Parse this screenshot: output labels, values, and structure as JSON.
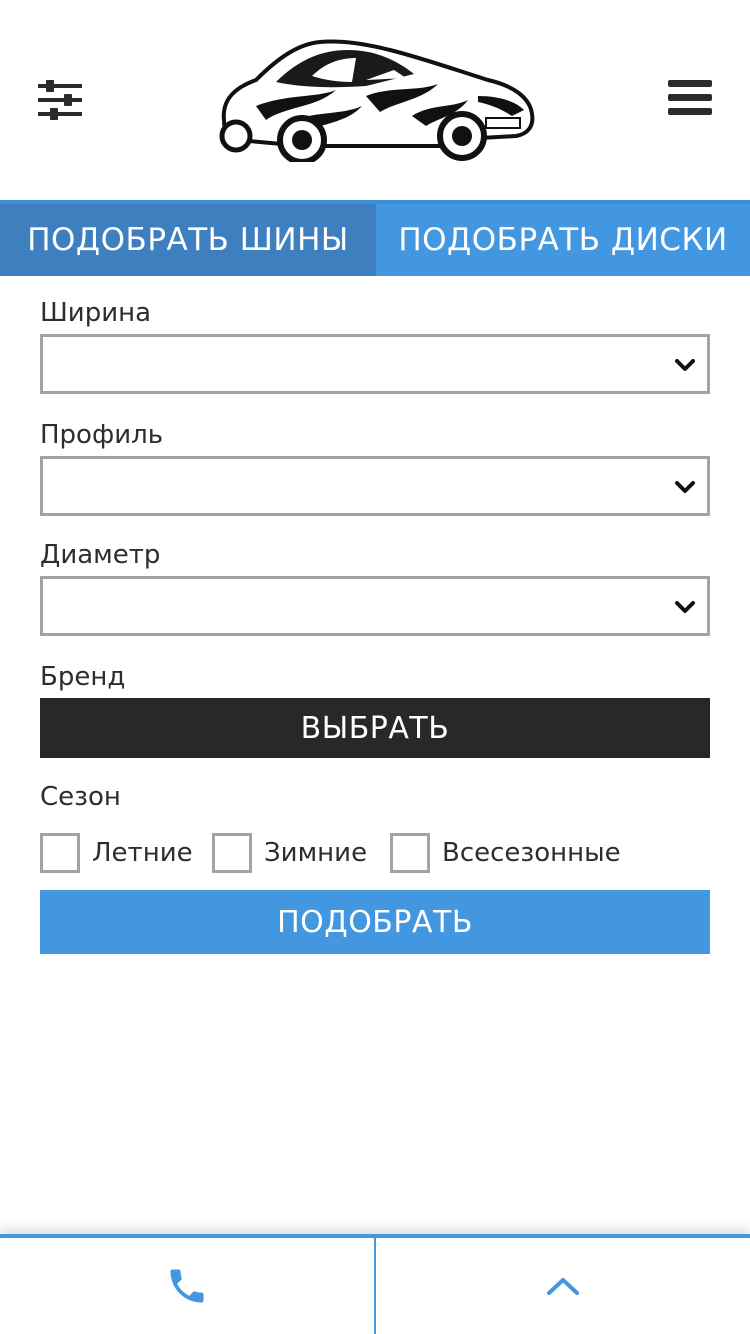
{
  "header": {
    "filter_icon": "sliders-icon",
    "menu_icon": "hamburger-menu-icon",
    "logo": "sports-car-logo"
  },
  "tabs": [
    {
      "label": "ПОДОБРАТЬ ШИНЫ",
      "active": true
    },
    {
      "label": "ПОДОБРАТЬ ДИСКИ",
      "active": false
    }
  ],
  "form": {
    "width": {
      "label": "Ширина",
      "value": ""
    },
    "profile": {
      "label": "Профиль",
      "value": ""
    },
    "diameter": {
      "label": "Диаметр",
      "value": ""
    },
    "brand": {
      "label": "Бренд",
      "button": "ВЫБРАТЬ"
    },
    "season": {
      "label": "Сезон",
      "options": [
        {
          "label": "Летние",
          "checked": false
        },
        {
          "label": "Зимние",
          "checked": false
        },
        {
          "label": "Всесезонные",
          "checked": false
        }
      ]
    },
    "submit": "ПОДОБРАТЬ"
  },
  "bottom_bar": {
    "left_icon": "phone-icon",
    "right_icon": "chevron-up-icon"
  },
  "colors": {
    "accent": "#4297e0",
    "tab_active": "#3e7fbf",
    "dark_button": "#282828",
    "border": "#a3a3a3"
  }
}
